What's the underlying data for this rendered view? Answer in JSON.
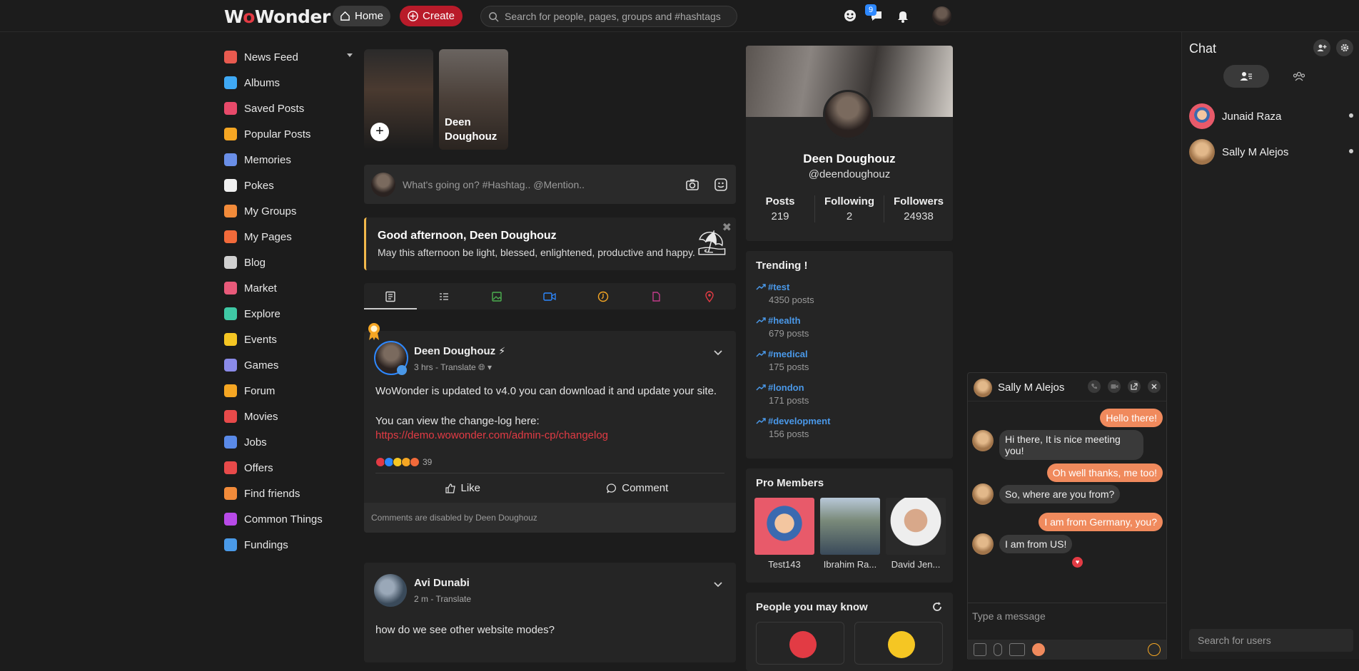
{
  "topbar": {
    "logo_prefix": "W",
    "logo_o": "o",
    "logo_suffix": "Wonder",
    "home_label": "Home",
    "create_label": "Create",
    "search_placeholder": "Search for people, pages, groups and #hashtags",
    "messages_badge": "9"
  },
  "leftnav": {
    "items": [
      {
        "label": "News Feed",
        "color": "#e85a4f"
      },
      {
        "label": "Albums",
        "color": "#3fa9f5"
      },
      {
        "label": "Saved Posts",
        "color": "#e84a6a"
      },
      {
        "label": "Popular Posts",
        "color": "#f5a623"
      },
      {
        "label": "Memories",
        "color": "#6a8fe8"
      },
      {
        "label": "Pokes",
        "color": "#f0f0f0"
      },
      {
        "label": "My Groups",
        "color": "#f28b3a"
      },
      {
        "label": "My Pages",
        "color": "#f26a3a"
      },
      {
        "label": "Blog",
        "color": "#d0d0d0"
      },
      {
        "label": "Market",
        "color": "#e85a7a"
      },
      {
        "label": "Explore",
        "color": "#3fc9a5"
      },
      {
        "label": "Events",
        "color": "#f5c623"
      },
      {
        "label": "Games",
        "color": "#8a8ae8"
      },
      {
        "label": "Forum",
        "color": "#f5a623"
      },
      {
        "label": "Movies",
        "color": "#e84a4a"
      },
      {
        "label": "Jobs",
        "color": "#5a8ae8"
      },
      {
        "label": "Offers",
        "color": "#e84a4a"
      },
      {
        "label": "Find friends",
        "color": "#f28b3a"
      },
      {
        "label": "Common Things",
        "color": "#b84ae8"
      },
      {
        "label": "Fundings",
        "color": "#4a9ae8"
      }
    ]
  },
  "stories": {
    "second_name": "Deen Doughouz"
  },
  "composer": {
    "placeholder": "What's going on? #Hashtag.. @Mention.."
  },
  "greeting": {
    "title": "Good afternoon, Deen Doughouz",
    "text": "May this afternoon be light, blessed, enlightened, productive and happy."
  },
  "post1": {
    "author": "Deen Doughouz",
    "meta": "3 hrs - Translate",
    "line1": "WoWonder is updated to v4.0 you can download it and update your site.",
    "line2": "You can view the change-log here:",
    "link": "https://demo.wowonder.com/admin-cp/changelog",
    "reaction_count": "39",
    "like_label": "Like",
    "comment_label": "Comment",
    "disabled_note": "Comments are disabled by Deen Doughouz"
  },
  "post2": {
    "author": "Avi Dunabi",
    "meta": "2 m - Translate",
    "text": "how do we see other website modes?"
  },
  "profile": {
    "name": "Deen Doughouz",
    "handle": "@deendoughouz",
    "stats": [
      {
        "label": "Posts",
        "value": "219"
      },
      {
        "label": "Following",
        "value": "2"
      },
      {
        "label": "Followers",
        "value": "24938"
      }
    ]
  },
  "trending": {
    "title": "Trending !",
    "items": [
      {
        "tag": "#test",
        "count": "4350 posts"
      },
      {
        "tag": "#health",
        "count": "679 posts"
      },
      {
        "tag": "#medical",
        "count": "175 posts"
      },
      {
        "tag": "#london",
        "count": "171 posts"
      },
      {
        "tag": "#development",
        "count": "156 posts"
      }
    ]
  },
  "pro": {
    "title": "Pro Members",
    "members": [
      {
        "name": "Test143"
      },
      {
        "name": "Ibrahim Ra..."
      },
      {
        "name": "David Jen..."
      }
    ]
  },
  "people": {
    "title": "People you may know"
  },
  "chatbox": {
    "name": "Sally M Alejos",
    "messages": [
      {
        "dir": "out",
        "text": "Hello there!"
      },
      {
        "dir": "in",
        "text": "Hi there, It is nice meeting you!"
      },
      {
        "dir": "out",
        "text": "Oh well thanks, me too!"
      },
      {
        "dir": "in",
        "text": "So, where are you from?"
      },
      {
        "dir": "out",
        "text": "I am from Germany, you?"
      },
      {
        "dir": "in",
        "text": "I am from US!"
      }
    ],
    "input_placeholder": "Type a message"
  },
  "chatpanel": {
    "title": "Chat",
    "users": [
      {
        "name": "Junaid Raza"
      },
      {
        "name": "Sally M Alejos"
      }
    ],
    "search_placeholder": "Search for users"
  }
}
